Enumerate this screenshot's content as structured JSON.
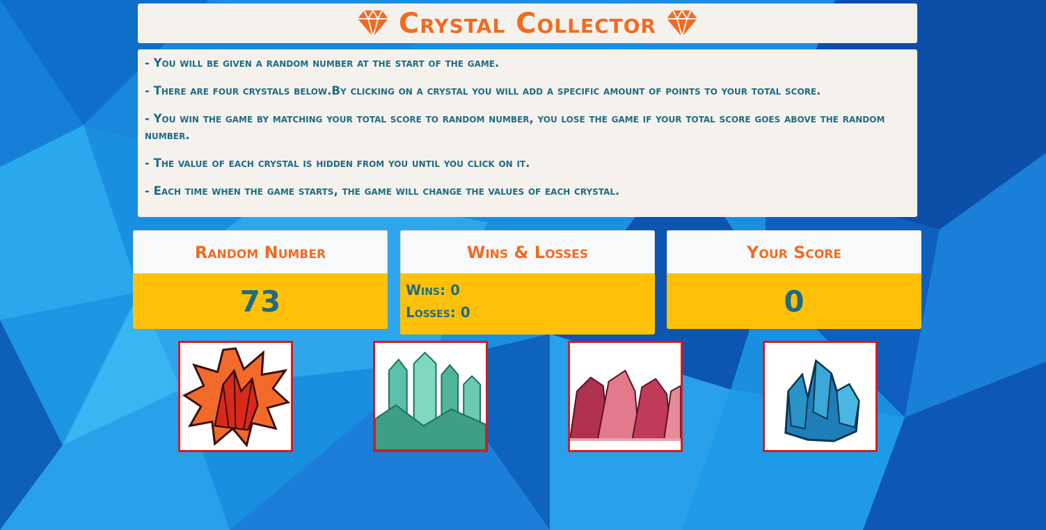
{
  "title": "Crystal Collector",
  "rules": [
    "- You will be given a random number at the start of the game.",
    "- There are four crystals below.By clicking on a crystal you will add a specific amount of points to your total score.",
    "- You win the game by matching your total score to random number, you lose the game if your total score goes above the random number.",
    "- The value of each crystal is hidden from you until you click on it.",
    "- Each time when the game starts, the game will change the values of each crystal."
  ],
  "random_card": {
    "heading": "Random Number",
    "value": "73"
  },
  "wl_card": {
    "heading": "Wins & Losses",
    "wins": "Wins: 0",
    "losses": "Losses: 0"
  },
  "score_card": {
    "heading": "Your Score",
    "value": "0"
  },
  "crystals": [
    {
      "icon": "red-crystal-icon"
    },
    {
      "icon": "green-crystal-icon"
    },
    {
      "icon": "pink-crystal-icon"
    },
    {
      "icon": "blue-crystal-icon"
    }
  ],
  "colors": {
    "accent_orange": "#f26b21",
    "text_teal": "#1e6b84",
    "panel_yellow": "#fec107",
    "panel_light": "#f5f2ee",
    "crystal_border": "#d81b1b"
  }
}
